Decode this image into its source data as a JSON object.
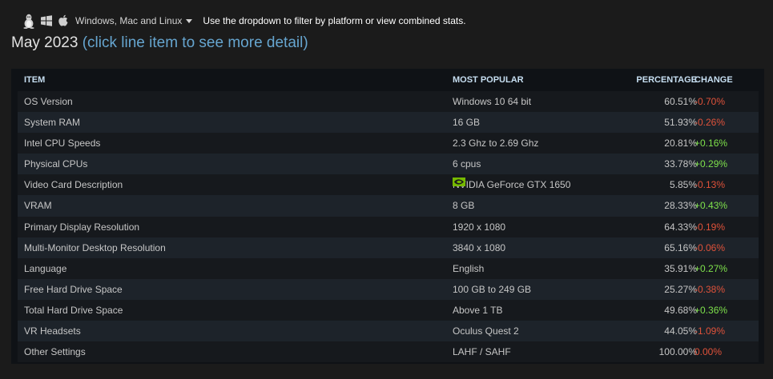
{
  "platform": {
    "icons": [
      "linux-icon",
      "windows-icon",
      "apple-icon"
    ],
    "selected": "Windows, Mac and Linux",
    "hint": "Use the dropdown to filter by platform or view combined stats."
  },
  "heading": {
    "month": "May 2023",
    "hint": "(click line item to see more detail)"
  },
  "table": {
    "columns": {
      "item": "ITEM",
      "popular": "MOST POPULAR",
      "percentage": "PERCENTAGE",
      "change": "CHANGE"
    },
    "rows": [
      {
        "item": "OS Version",
        "popular": "Windows 10 64 bit",
        "percentage": "60.51%",
        "change": "-0.70%",
        "trend": "neg"
      },
      {
        "item": "System RAM",
        "popular": "16 GB",
        "percentage": "51.93%",
        "change": "-0.26%",
        "trend": "neg"
      },
      {
        "item": "Intel CPU Speeds",
        "popular": "2.3 Ghz to 2.69 Ghz",
        "percentage": "20.81%",
        "change": "+0.16%",
        "trend": "pos"
      },
      {
        "item": "Physical CPUs",
        "popular": "6 cpus",
        "percentage": "33.78%",
        "change": "+0.29%",
        "trend": "pos"
      },
      {
        "item": "Video Card Description",
        "popular": "NVIDIA GeForce GTX 1650",
        "percentage": "5.85%",
        "change": "-0.13%",
        "trend": "neg",
        "icon": "nvidia-icon"
      },
      {
        "item": "VRAM",
        "popular": "8 GB",
        "percentage": "28.33%",
        "change": "+0.43%",
        "trend": "pos"
      },
      {
        "item": "Primary Display Resolution",
        "popular": "1920 x 1080",
        "percentage": "64.33%",
        "change": "-0.19%",
        "trend": "neg"
      },
      {
        "item": "Multi-Monitor Desktop Resolution",
        "popular": "3840 x 1080",
        "percentage": "65.16%",
        "change": "-0.06%",
        "trend": "neg"
      },
      {
        "item": "Language",
        "popular": "English",
        "percentage": "35.91%",
        "change": "+0.27%",
        "trend": "pos"
      },
      {
        "item": "Free Hard Drive Space",
        "popular": "100 GB to 249 GB",
        "percentage": "25.27%",
        "change": "-0.38%",
        "trend": "neg"
      },
      {
        "item": "Total Hard Drive Space",
        "popular": "Above 1 TB",
        "percentage": "49.68%",
        "change": "+0.36%",
        "trend": "pos"
      },
      {
        "item": "VR Headsets",
        "popular": "Oculus Quest 2",
        "percentage": "44.05%",
        "change": "-1.09%",
        "trend": "neg"
      },
      {
        "item": "Other Settings",
        "popular": "LAHF / SAHF",
        "percentage": "100.00%",
        "change": "0.00%",
        "trend": "neg"
      }
    ]
  },
  "colors": {
    "negative": "#e0523a",
    "positive": "#7ee14b",
    "hint": "#66a5cf",
    "nvidia": "#76b900"
  }
}
